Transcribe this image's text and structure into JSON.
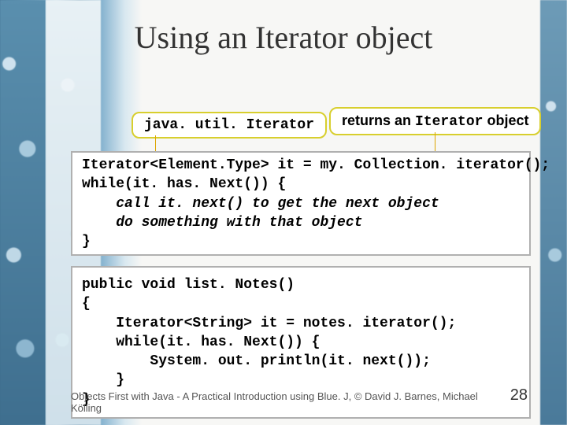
{
  "title": "Using an Iterator object",
  "labels": {
    "left": "java. util. Iterator",
    "right_prefix": "returns an ",
    "right_code": "Iterator",
    "right_suffix": " object"
  },
  "code1": {
    "l1": "Iterator<Element.Type> it = my. Collection. iterator();",
    "l2": "while(it. has. Next()) {",
    "l3": "    call it. next() to get the next object",
    "l4": "    do something with that object",
    "l5": "}"
  },
  "code2": {
    "l1": "public void list. Notes()",
    "l2": "{",
    "l3": "    Iterator<String> it = notes. iterator();",
    "l4": "    while(it. has. Next()) {",
    "l5": "        System. out. println(it. next());",
    "l6": "    }",
    "l7": "}"
  },
  "footer": {
    "text": "Objects First with Java - A Practical Introduction using Blue. J, © David J. Barnes, Michael Kölling",
    "page": "28"
  }
}
